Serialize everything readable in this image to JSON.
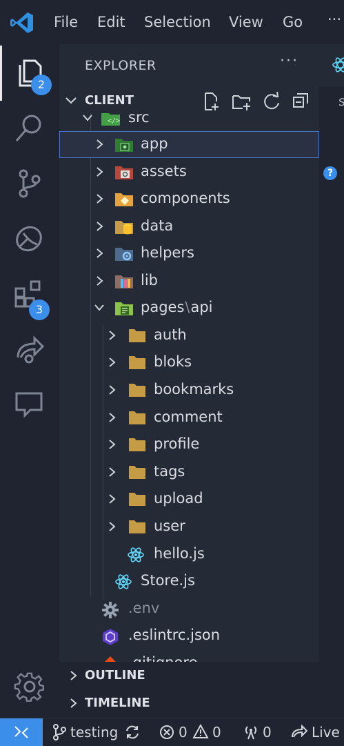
{
  "menu": {
    "file": "File",
    "edit": "Edit",
    "selection": "Selection",
    "view": "View",
    "go": "Go",
    "more": "···"
  },
  "activity": {
    "explorer_badge": "2",
    "extensions_badge": "3"
  },
  "explorer": {
    "title": "EXPLORER",
    "more": "···",
    "project": "CLIENT",
    "tree": {
      "src": "src",
      "app": "app",
      "assets": "assets",
      "components": "components",
      "data": "data",
      "helpers": "helpers",
      "lib": "lib",
      "pages": "pages",
      "sep": "\\",
      "api": "api",
      "auth": "auth",
      "bloks": "bloks",
      "bookmarks": "bookmarks",
      "comment": "comment",
      "profile": "profile",
      "tags": "tags",
      "upload": "upload",
      "user": "user",
      "hello": "hello.js",
      "store": "Store.js",
      "env": ".env",
      "eslint": ".eslintrc.json",
      "gitignore": ".gitignore"
    },
    "outline": "OUTLINE",
    "timeline": "TIMELINE"
  },
  "editor": {
    "tab_char": "s",
    "help": "?"
  },
  "status": {
    "branch": "testing",
    "errors": "0",
    "warnings": "0",
    "ports": "0",
    "live": "Live S"
  },
  "colors": {
    "accent": "#3b8eea",
    "folder": "#c59b45",
    "react": "#61dafb"
  }
}
